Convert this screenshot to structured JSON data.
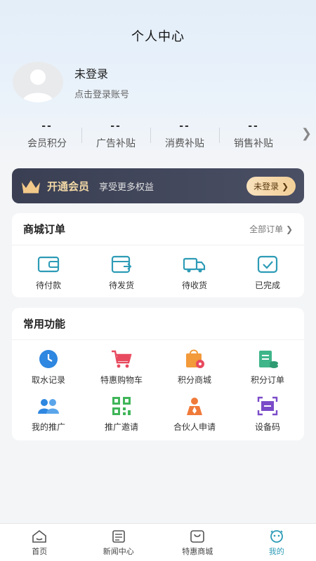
{
  "header": {
    "title": "个人中心"
  },
  "profile": {
    "name": "未登录",
    "subtitle": "点击登录账号"
  },
  "stats": [
    {
      "value": "--",
      "label": "会员积分"
    },
    {
      "value": "--",
      "label": "广告补贴"
    },
    {
      "value": "--",
      "label": "消费补贴"
    },
    {
      "value": "--",
      "label": "销售补贴"
    }
  ],
  "vip": {
    "title": "开通会员",
    "subtitle": "享受更多权益",
    "button": "未登录 ❯"
  },
  "orders": {
    "title": "商城订单",
    "all_link": "全部订单 ❯",
    "items": [
      {
        "label": "待付款",
        "icon": "wallet-icon"
      },
      {
        "label": "待发货",
        "icon": "ship-box-icon"
      },
      {
        "label": "待收货",
        "icon": "truck-icon"
      },
      {
        "label": "已完成",
        "icon": "done-icon"
      }
    ]
  },
  "functions": {
    "title": "常用功能",
    "items": [
      {
        "label": "取水记录",
        "icon": "clock-icon"
      },
      {
        "label": "特惠购物车",
        "icon": "cart-icon"
      },
      {
        "label": "积分商城",
        "icon": "shop-bag-icon"
      },
      {
        "label": "积分订单",
        "icon": "order-coins-icon"
      },
      {
        "label": "我的推广",
        "icon": "users-icon"
      },
      {
        "label": "推广邀请",
        "icon": "qrcode-icon"
      },
      {
        "label": "合伙人申请",
        "icon": "partner-icon"
      },
      {
        "label": "设备码",
        "icon": "scan-icon"
      }
    ]
  },
  "tabbar": [
    {
      "label": "首页",
      "icon": "home-icon"
    },
    {
      "label": "新闻中心",
      "icon": "news-icon"
    },
    {
      "label": "特惠商城",
      "icon": "mall-icon"
    },
    {
      "label": "我的",
      "icon": "me-icon",
      "active": true
    }
  ],
  "colors": {
    "accent": "#2d9bb6",
    "vip_gold": "#f3d9a6",
    "vip_bg": "#3a3f53"
  }
}
